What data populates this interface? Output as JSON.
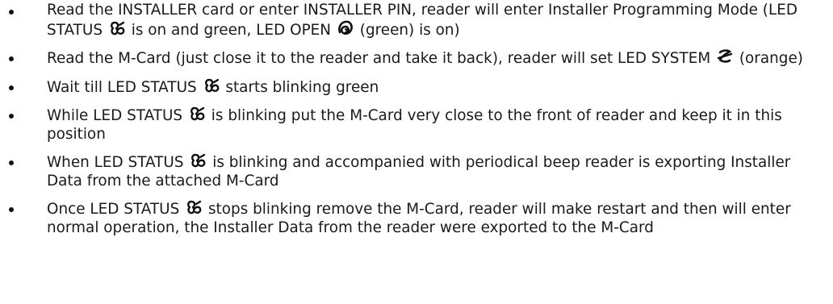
{
  "items": [
    {
      "parts": [
        {
          "t": "text",
          "v": "Read the INSTALLER card or enter INSTALLER PIN, reader will enter Installer Programming Mode (LED STATUS "
        },
        {
          "t": "icon",
          "v": "status-led-icon"
        },
        {
          "t": "text",
          "v": " is on and green,  LED OPEN "
        },
        {
          "t": "icon",
          "v": "open-led-icon"
        },
        {
          "t": "text",
          "v": " (green) is on)"
        }
      ]
    },
    {
      "parts": [
        {
          "t": "text",
          "v": "Read the M-Card (just close it to the reader and take it back), reader will set LED SYSTEM "
        },
        {
          "t": "icon",
          "v": "system-led-icon"
        },
        {
          "t": "text",
          "v": " (orange)"
        }
      ]
    },
    {
      "parts": [
        {
          "t": "text",
          "v": "Wait till LED STATUS "
        },
        {
          "t": "icon",
          "v": "status-led-icon"
        },
        {
          "t": "text",
          "v": " starts blinking green"
        }
      ]
    },
    {
      "parts": [
        {
          "t": "text",
          "v": "While LED STATUS "
        },
        {
          "t": "icon",
          "v": "status-led-icon"
        },
        {
          "t": "text",
          "v": " is blinking put the M-Card very close to the front of reader and keep it in this position"
        }
      ]
    },
    {
      "parts": [
        {
          "t": "text",
          "v": "When LED STATUS "
        },
        {
          "t": "icon",
          "v": "status-led-icon"
        },
        {
          "t": "text",
          "v": " is blinking and accompanied with periodical beep reader is exporting Installer Data from the attached M-Card"
        }
      ]
    },
    {
      "parts": [
        {
          "t": "text",
          "v": "Once LED STATUS "
        },
        {
          "t": "icon",
          "v": "status-led-icon"
        },
        {
          "t": "text",
          "v": " stops blinking remove the M-Card, reader will make restart and then will enter normal operation, the Installer Data from the reader were exported to the M-Card"
        }
      ]
    }
  ]
}
